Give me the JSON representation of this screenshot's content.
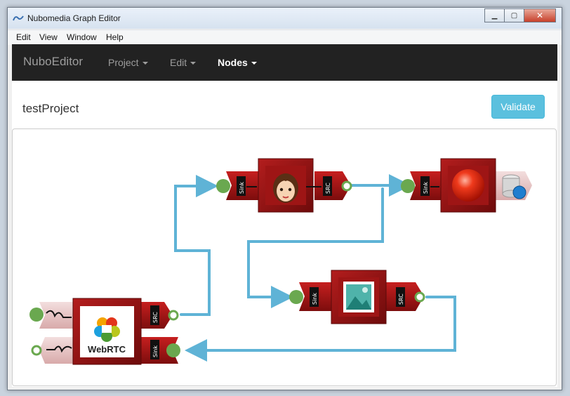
{
  "window": {
    "title": "Nubomedia Graph Editor"
  },
  "menu": {
    "items": [
      "Edit",
      "View",
      "Window",
      "Help"
    ]
  },
  "navbar": {
    "brand": "NuboEditor",
    "project": "Project",
    "edit": "Edit",
    "nodes": "Nodes"
  },
  "page": {
    "project_name": "testProject",
    "validate_label": "Validate"
  },
  "graph": {
    "sink_label": "Sink",
    "src_label": "SRC",
    "webrtc_label": "WebRTC",
    "colors": {
      "node": "#8b1010",
      "link": "#5fb3d6",
      "port_in": "#6aa84f"
    }
  }
}
